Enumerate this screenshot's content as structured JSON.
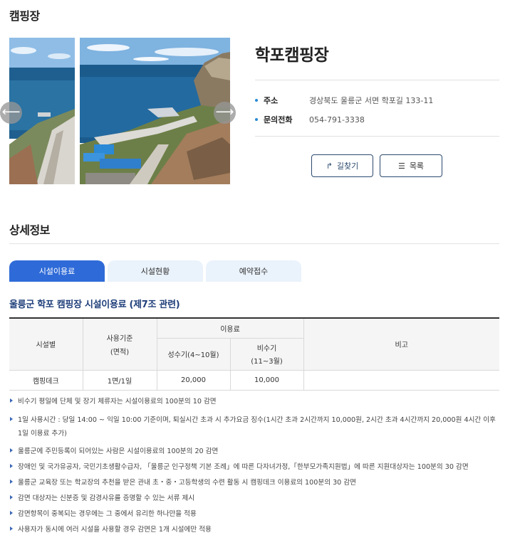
{
  "section_title": "캠핑장",
  "place": {
    "name": "학포캠핑장",
    "info": [
      {
        "label": "주소",
        "value": "경상북도 울릉군 서면 학포길 133-11"
      },
      {
        "label": "문의전화",
        "value": "054-791-3338"
      }
    ]
  },
  "gallery": {
    "prev_icon": "chevron-left-icon",
    "next_icon": "chevron-right-icon",
    "prev_glyph": "⟵",
    "next_glyph": "⟶"
  },
  "buttons": {
    "route_label": "길찾기",
    "route_icon": "share-arrow-icon",
    "route_glyph": "↱",
    "list_label": "목록",
    "list_icon": "menu-icon",
    "list_glyph": "☰"
  },
  "detail_title": "상세정보",
  "tabs": [
    {
      "label": "시설이용료",
      "active": true
    },
    {
      "label": "시설현황",
      "active": false
    },
    {
      "label": "예약접수",
      "active": false
    }
  ],
  "table_title": "울릉군 학포 캠핑장 시설이용료 (제7조 관련)",
  "fee_table": {
    "headers": {
      "facility": "시설별",
      "usage_line1": "사용기준",
      "usage_line2": "(면적)",
      "fee": "이용료",
      "peak": "성수기(4~10월)",
      "offpeak_line1": "비수기",
      "offpeak_line2": "(11~3월)",
      "note": "비고"
    },
    "rows": [
      {
        "facility": "캠핑데크",
        "usage": "1면/1일",
        "peak": "20,000",
        "offpeak": "10,000",
        "note": ""
      }
    ]
  },
  "notes": [
    {
      "line1": "비수기 평일에 단체 및 장기 체류자는 시설이용료의 100분의 10 감면"
    },
    {
      "line1": "1일 사용시간 : 당일 14:00 ~ 익일 10:00 기준이며, 퇴실시간 초과 시 추가요금 징수(1시간 초과 2시간까지 10,000원, 2시간 초과 4시간까지 20,000원 4시간 이후",
      "line2": "1일 이용료 추가)"
    },
    {
      "line1": "울릉군에 주민등록이 되어있는 사람은 시설이용료의 100분의 20 감면"
    },
    {
      "line1": "장애인 및 국가유공자, 국민기초생활수급자, 「울릉군 인구정책 기본 조례」에 따른 다자녀가정,「한부모가족지원법」에 따른 지원대상자는 100분의 30 감면"
    },
    {
      "line1": "울릉군 교육장 또는 학교장의 추천을 받은 관내 초・중・고등학생의 수련 활동 시 캠핑데크 이용료의 100분의 30 감면"
    },
    {
      "line1": "감면 대상자는 신분증 및 감경사유를 증명할 수 있는 서류 제시"
    },
    {
      "line1": "감면항목이 중복되는 경우에는 그 중에서 유리한 하나만을 적용"
    },
    {
      "line1": "사용자가 동시에 여러 시설을 사용할 경우 감면은 1개 시설에만 적용"
    }
  ],
  "colors": {
    "accent": "#2f6bd8",
    "tab_inactive": "#eaf2fb",
    "title_navy": "#1f3f7a",
    "button_border": "#2c4a6e"
  }
}
